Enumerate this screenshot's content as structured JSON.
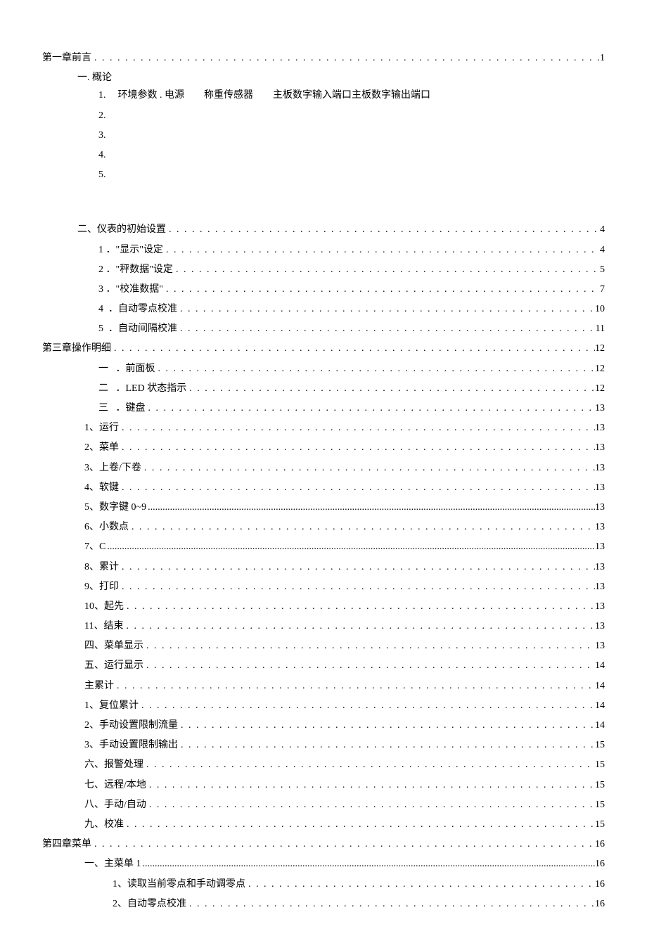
{
  "toc": {
    "l1": {
      "label": "第一章前言",
      "page": "1"
    },
    "l2": {
      "label": "一. 概论"
    },
    "l3": {
      "num": "1.",
      "label": "环境参数 . 电源　　称重传感器　　主板数字输入端口主板数字输出端口"
    },
    "l4": {
      "num": "2."
    },
    "l5": {
      "num": "3."
    },
    "l6": {
      "num": "4."
    },
    "l7": {
      "num": "5."
    },
    "l8": {
      "label": "二、仪表的初始设置",
      "page": "4"
    },
    "l9": {
      "num": "1",
      "label": "．\"显示\"设定",
      "page": "4"
    },
    "l10": {
      "num": "2",
      "label": "．\"秤数据\"设定",
      "page": "5"
    },
    "l11": {
      "num": "3",
      "label": "．\"校准数据\"",
      "page": "7"
    },
    "l12": {
      "num": "4",
      "label": "．自动零点校准",
      "page": "10"
    },
    "l13": {
      "num": "5",
      "label": "．自动间隔校准",
      "page": "11"
    },
    "l14": {
      "label": "第三章操作明细",
      "page": "12"
    },
    "l15": {
      "num": "一",
      "label": "．前面板",
      "page": "12"
    },
    "l16": {
      "num": "二",
      "label": "．LED 状态指示",
      "page": "12"
    },
    "l17": {
      "num": "三",
      "label": "．键盘",
      "page": "13"
    },
    "l18": {
      "label": "1、运行",
      "page": "13"
    },
    "l19": {
      "label": "2、菜单",
      "page": "13"
    },
    "l20": {
      "label": "3、上卷/下卷",
      "page": "13"
    },
    "l21": {
      "label": "4、软键",
      "page": "13"
    },
    "l22": {
      "label": "5、数字键 0~9",
      "page": "13"
    },
    "l23": {
      "label": "6、小数点",
      "page": "13"
    },
    "l24": {
      "label": "7、C",
      "page": "13"
    },
    "l25": {
      "label": "8、累计",
      "page": "13"
    },
    "l26": {
      "label": "9、打印",
      "page": "13"
    },
    "l27": {
      "label": "10、起先",
      "page": "13"
    },
    "l28": {
      "label": "11、结束",
      "page": "13"
    },
    "l29": {
      "label": "四、菜单显示",
      "page": "13"
    },
    "l30": {
      "label": "五、运行显示",
      "page": "14"
    },
    "l31": {
      "label": "主累计",
      "page": "14"
    },
    "l32": {
      "label": "1、复位累计",
      "page": "14"
    },
    "l33": {
      "label": "2、手动设置限制流量",
      "page": "14"
    },
    "l34": {
      "label": "3、手动设置限制输出",
      "page": "15"
    },
    "l35": {
      "label": "六、报警处理",
      "page": "15"
    },
    "l36": {
      "label": "七、远程/本地",
      "page": "15"
    },
    "l37": {
      "label": "八、手动/自动",
      "page": "15"
    },
    "l38": {
      "label": "九、校准",
      "page": "15"
    },
    "l39": {
      "label": "第四章菜单",
      "page": "16"
    },
    "l40": {
      "label": "一、主菜单 1",
      "page": "16"
    },
    "l41": {
      "label": "1、读取当前零点和手动调零点",
      "page": "16"
    },
    "l42": {
      "label": "2、自动零点校准",
      "page": "16"
    }
  }
}
